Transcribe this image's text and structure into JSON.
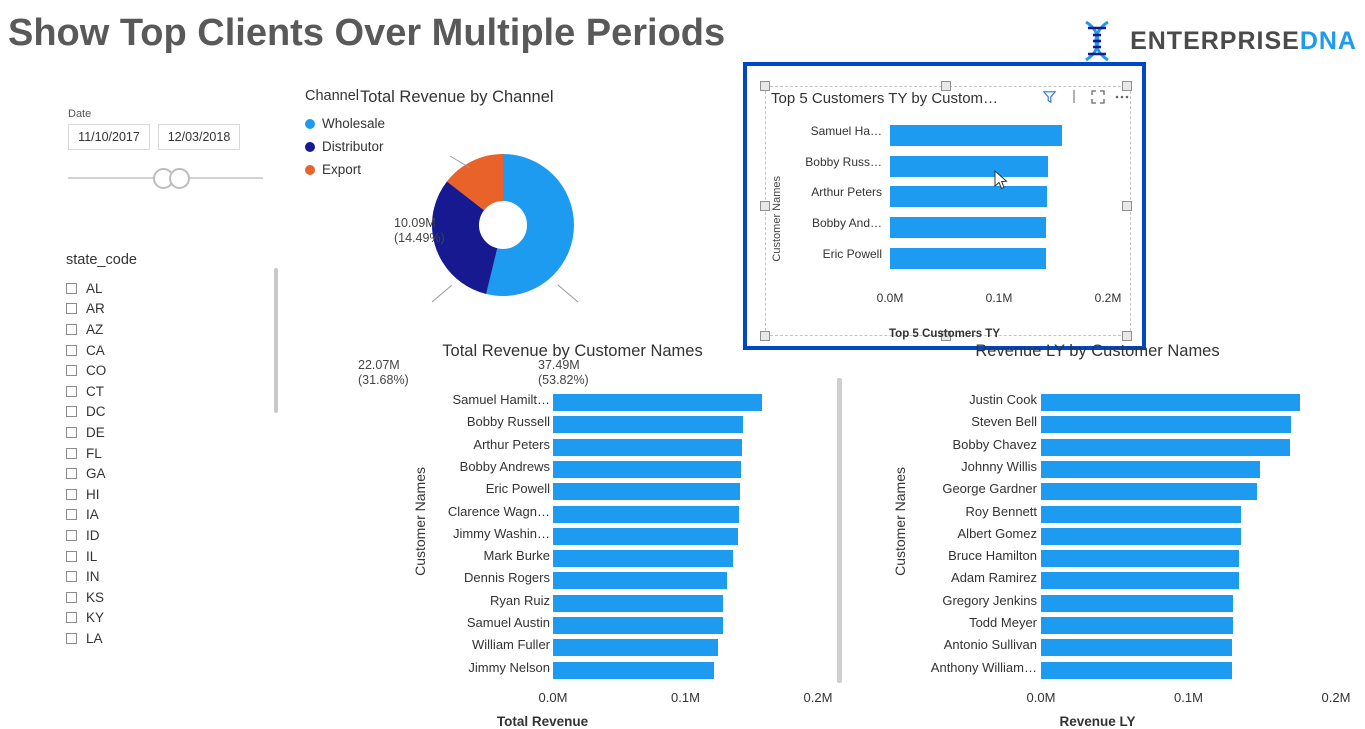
{
  "header": {
    "title": "Show Top Clients Over Multiple Periods",
    "brand_dark": "ENTERPRISE",
    "brand_blue": "DNA",
    "logo_icon": "dna-helix-icon"
  },
  "date_slicer": {
    "label": "Date",
    "start": "11/10/2017",
    "end": "12/03/2018"
  },
  "state_slicer": {
    "title": "state_code",
    "items": [
      "AL",
      "AR",
      "AZ",
      "CA",
      "CO",
      "CT",
      "DC",
      "DE",
      "FL",
      "GA",
      "HI",
      "IA",
      "ID",
      "IL",
      "IN",
      "KS",
      "KY",
      "LA"
    ]
  },
  "donut": {
    "title": "Total Revenue by Channel",
    "legend_title": "Channel",
    "labels": {
      "wholesale": "37.49M\n(53.82%)",
      "distributor": "22.07M\n(31.68%)",
      "export": "10.09M\n(14.49%)"
    }
  },
  "highlight": {
    "title": "Top 5 Customers TY by Custom…",
    "axis_title": "Top 5 Customers TY",
    "ylabel": "Customer Names",
    "icons": [
      "filter-icon",
      "focus-mode-icon",
      "more-options-icon"
    ],
    "ticks": [
      "0.0M",
      "0.1M",
      "0.2M"
    ]
  },
  "chart_data": [
    {
      "type": "pie",
      "title": "Total Revenue by Channel",
      "labels": [
        "Wholesale",
        "Distributor",
        "Export"
      ],
      "values": [
        37.49,
        22.07,
        10.09
      ],
      "value_labels": [
        "37.49M\n(53.82%)",
        "22.07M\n(31.68%)",
        "10.09M\n(14.49%)"
      ],
      "percents": [
        53.82,
        31.68,
        14.49
      ],
      "colors": [
        "#1d9bf0",
        "#16198f",
        "#e8622a"
      ],
      "legend_title": "Channel",
      "legend_position": "right",
      "donut": true
    },
    {
      "type": "bar",
      "orientation": "horizontal",
      "title": "Top 5 Customers TY by Customer Names",
      "xlabel": "Top 5 Customers TY",
      "ylabel": "Customer Names",
      "xlim": [
        0,
        0.2
      ],
      "xticks": [
        "0.0M",
        "0.1M",
        "0.2M"
      ],
      "categories": [
        "Samuel Ha…",
        "Bobby Russ…",
        "Arthur Peters",
        "Bobby And…",
        "Eric Powell"
      ],
      "values": [
        0.158,
        0.145,
        0.144,
        0.143,
        0.143
      ],
      "grid": false,
      "color": "#1d9bf0"
    },
    {
      "type": "bar",
      "orientation": "horizontal",
      "title": "Total Revenue by Customer Names",
      "xlabel": "Total Revenue",
      "ylabel": "Customer Names",
      "xlim": [
        0,
        0.2
      ],
      "xticks": [
        "0.0M",
        "0.1M",
        "0.2M"
      ],
      "categories": [
        "Samuel Hamilt…",
        "Bobby Russell",
        "Arthur Peters",
        "Bobby Andrews",
        "Eric Powell",
        "Clarence Wagn…",
        "Jimmy Washin…",
        "Mark Burke",
        "Dennis Rogers",
        "Ryan Ruiz",
        "Samuel Austin",
        "William Fuller",
        "Jimmy Nelson"
      ],
      "values": [
        0.158,
        0.1435,
        0.1425,
        0.142,
        0.1415,
        0.1405,
        0.1395,
        0.1355,
        0.1315,
        0.1285,
        0.1285,
        0.1245,
        0.1215
      ],
      "grid": false,
      "color": "#1d9bf0"
    },
    {
      "type": "bar",
      "orientation": "horizontal",
      "title": "Revenue LY by Customer Names",
      "xlabel": "Revenue LY",
      "ylabel": "Customer Names",
      "xlim": [
        0,
        0.2
      ],
      "xticks": [
        "0.0M",
        "0.1M",
        "0.2M"
      ],
      "categories": [
        "Justin Cook",
        "Steven Bell",
        "Bobby Chavez",
        "Johnny Willis",
        "George Gardner",
        "Roy Bennett",
        "Albert Gomez",
        "Bruce Hamilton",
        "Adam Ramirez",
        "Gregory Jenkins",
        "Todd Meyer",
        "Antonio Sullivan",
        "Anthony William…"
      ],
      "values": [
        0.1755,
        0.1695,
        0.1685,
        0.1485,
        0.1465,
        0.1355,
        0.1355,
        0.1345,
        0.1345,
        0.1305,
        0.1305,
        0.1295,
        0.1295
      ],
      "grid": false,
      "color": "#1d9bf0"
    }
  ],
  "bottom_left": {
    "title": "Total Revenue by Customer Names",
    "axis_title": "Total Revenue",
    "ylabel": "Customer Names",
    "ticks": [
      "0.0M",
      "0.1M",
      "0.2M"
    ]
  },
  "bottom_right": {
    "title": "Revenue LY by Customer Names",
    "axis_title": "Revenue LY",
    "ylabel": "Customer Names",
    "ticks": [
      "0.0M",
      "0.1M",
      "0.2M"
    ]
  }
}
